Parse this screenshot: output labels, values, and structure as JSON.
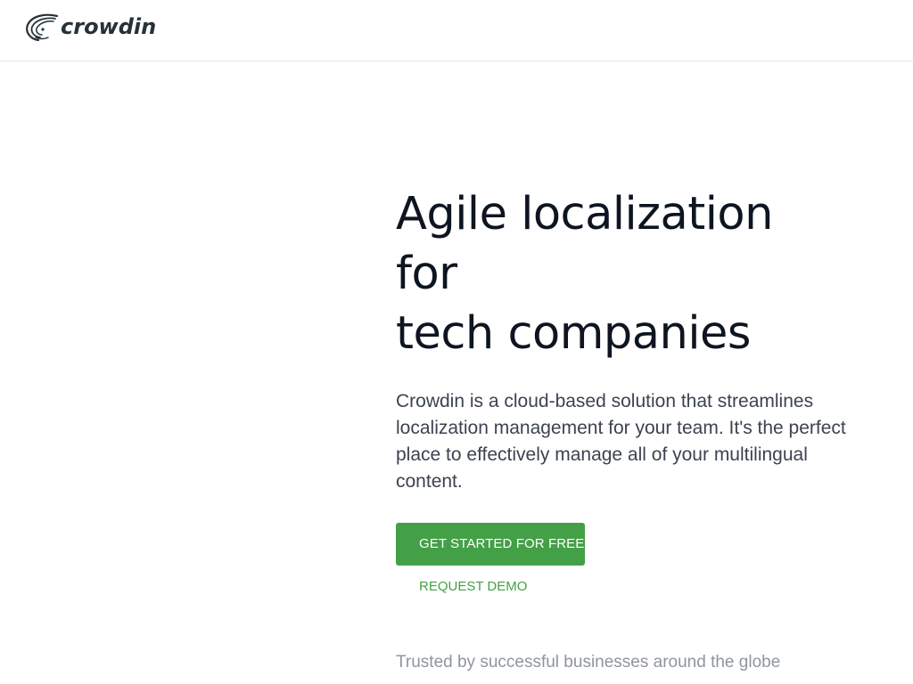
{
  "header": {
    "logo_text": "crowdin"
  },
  "hero": {
    "title_line_1": "Agile localization",
    "title_line_2": "for",
    "title_line_3": "tech companies",
    "description": "Crowdin is a cloud-based solution that streamlines localization management for your team. It's the perfect place to effectively manage all of your multilingual content.",
    "primary_cta": "GET STARTED FOR FREE",
    "secondary_cta": "REQUEST DEMO"
  },
  "trusted": {
    "text": "Trusted by successful businesses around the globe"
  },
  "colors": {
    "brand_green": "#43a047",
    "heading": "#0d1521",
    "body_text": "#3c4350",
    "muted_text": "#8f959e",
    "logo": "#263238"
  },
  "icons": {
    "logo_mark": "crowdin-swirl-logo-icon"
  }
}
